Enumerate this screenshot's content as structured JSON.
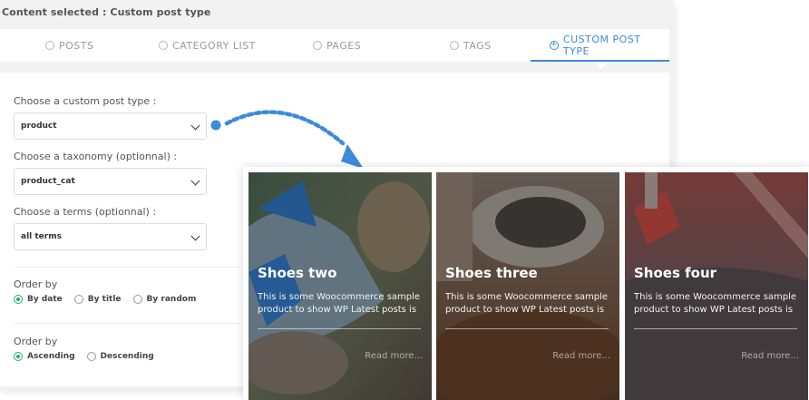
{
  "panel": {
    "title": "Content selected : Custom post type"
  },
  "tabs": [
    {
      "label": "POSTS"
    },
    {
      "label": "CATEGORY LIST"
    },
    {
      "label": "PAGES"
    },
    {
      "label": "TAGS"
    },
    {
      "label": "CUSTOM POST TYPE",
      "active": true
    }
  ],
  "form": {
    "post_type_label": "Choose a custom post type :",
    "post_type_value": "product",
    "taxonomy_label": "Choose a taxonomy (optionnal) :",
    "taxonomy_value": "product_cat",
    "terms_label": "Choose a terms (optionnal) :",
    "terms_value": "all terms",
    "order_by_label": "Order by",
    "order_by_options": [
      {
        "label": "By date",
        "checked": true
      },
      {
        "label": "By title",
        "checked": false
      },
      {
        "label": "By random",
        "checked": false
      }
    ],
    "order_label": "Order by",
    "order_options": [
      {
        "label": "Ascending",
        "checked": true
      },
      {
        "label": "Descending",
        "checked": false
      }
    ]
  },
  "cards": [
    {
      "title": "Shoes two",
      "description": "This is some Woocommerce sample product to show WP Latest posts is",
      "read_more": "Read more...",
      "image": "sneaker-photo"
    },
    {
      "title": "Shoes three",
      "description": "This is some Woocommerce sample product to show WP Latest posts is",
      "read_more": "Read more...",
      "image": "shoe-polish-photo"
    },
    {
      "title": "Shoes four",
      "description": "This is some Woocommerce sample product to show WP Latest posts is",
      "read_more": "Read more...",
      "image": "running-road-photo"
    }
  ],
  "colors": {
    "accent": "#3d8bdb",
    "radio_checked": "#27ae60"
  }
}
